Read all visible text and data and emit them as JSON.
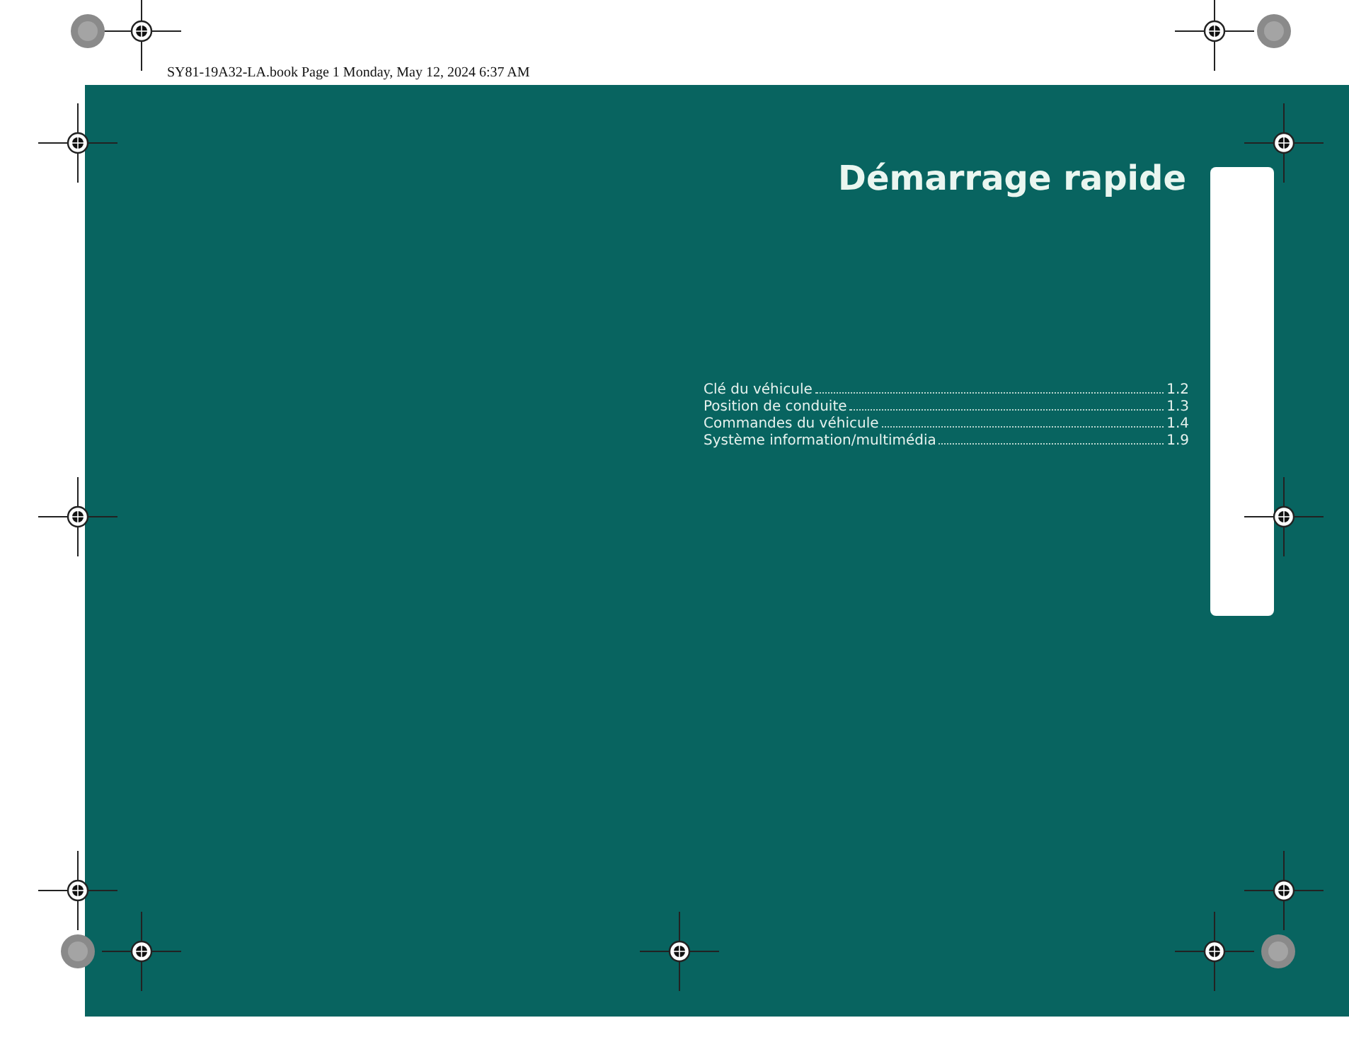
{
  "print_header": "SY81-19A32-LA.book Page 1 Monday, May 12, 2024 6:37 AM",
  "title": "Démarrage rapide",
  "contents": [
    {
      "label": "Clé du véhicule",
      "page": "1.2"
    },
    {
      "label": "Position de conduite",
      "page": "1.3"
    },
    {
      "label": "Commandes du véhicule",
      "page": "1.4"
    },
    {
      "label": "Système information/multimédia",
      "page": "1.9"
    }
  ]
}
